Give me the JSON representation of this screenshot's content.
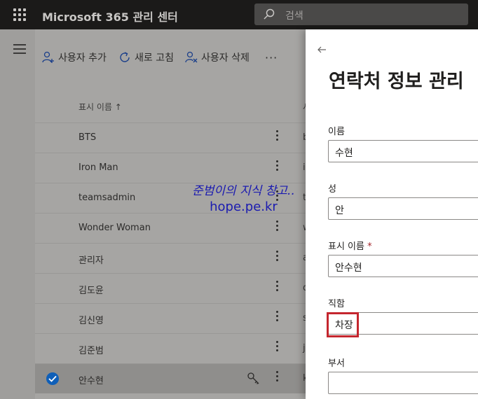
{
  "header": {
    "app_title": "Microsoft 365 관리 센터",
    "search_placeholder": "검색"
  },
  "toolbar": {
    "add_user": "사용자 추가",
    "refresh": "새로 고침",
    "delete_user": "사용자 삭제",
    "more": "···"
  },
  "table": {
    "header_display_name": "표시 이름 ↑",
    "header_truncated": "사",
    "rows": [
      {
        "name": "BTS",
        "trunc": "b"
      },
      {
        "name": "Iron Man",
        "trunc": "i"
      },
      {
        "name": "teamsadmin",
        "trunc": "t"
      },
      {
        "name": "Wonder Woman",
        "trunc": "w"
      },
      {
        "name": "관리자",
        "trunc": "a"
      },
      {
        "name": "김도윤",
        "trunc": "d"
      },
      {
        "name": "김신영",
        "trunc": "s"
      },
      {
        "name": "김준범",
        "trunc": "j"
      },
      {
        "name": "안수현",
        "trunc": "k",
        "selected": true
      }
    ]
  },
  "watermark": {
    "line1": "준범이의 지식 창고..",
    "line2": "hope.pe.kr"
  },
  "panel": {
    "title": "연락처 정보 관리",
    "fields": [
      {
        "label": "이름",
        "value": "수현"
      },
      {
        "label": "성",
        "value": "안"
      },
      {
        "label": "표시 이름",
        "required_mark": "*",
        "value": "안수현"
      },
      {
        "label": "직함",
        "value": "차장"
      },
      {
        "label": "부서",
        "value": ""
      }
    ]
  },
  "colors": {
    "highlight": "#c4262e",
    "selected_check": "#0f5fb8"
  }
}
